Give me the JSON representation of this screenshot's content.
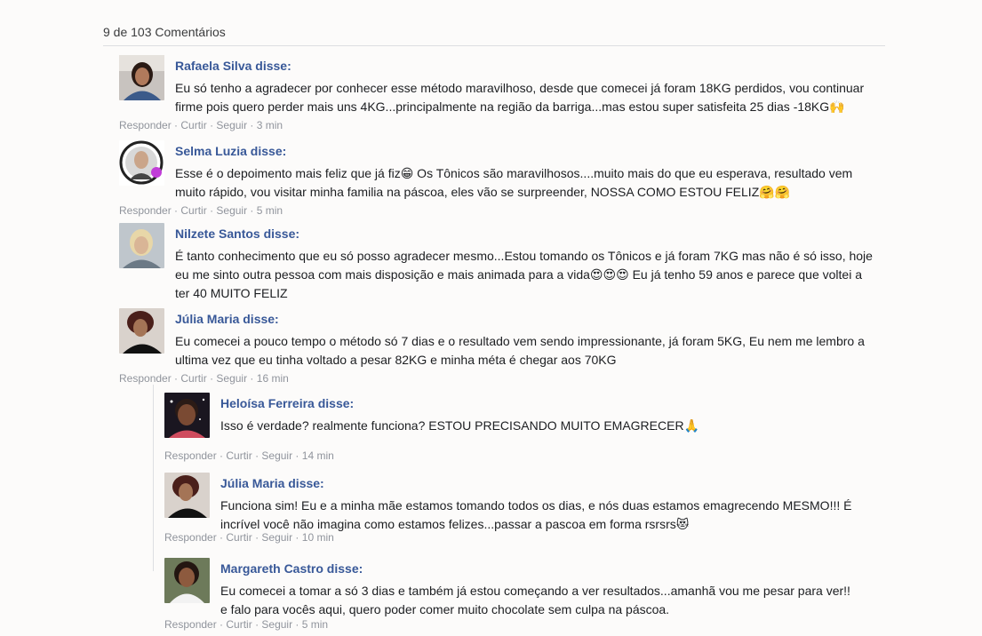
{
  "header": {
    "count_label": "9 de 103 Comentários"
  },
  "actions": {
    "reply": "Responder",
    "like": "Curtir",
    "follow": "Seguir",
    "sep": " · "
  },
  "comments": [
    {
      "name": "Rafaela Silva disse:",
      "text": "Eu só tenho a agradecer por conhecer esse método maravilhoso, desde que comecei já foram 18KG perdidos, vou continuar firme pois quero perder mais uns 4KG...principalmente na região da barriga...mas estou super satisfeita 25 dias -18KG🙌",
      "time": "3 min"
    },
    {
      "name": "Selma Luzia disse:",
      "text": "Esse é o depoimento mais feliz que já fiz😁 Os Tônicos são maravilhosos....muito mais do que eu esperava, resultado vem muito rápido, vou visitar minha familia na páscoa, eles vão se surpreender, NOSSA COMO ESTOU FELIZ🤗🤗",
      "time": "5 min"
    },
    {
      "name": "Nilzete Santos disse:",
      "text": "É tanto conhecimento que eu só posso agradecer mesmo...Estou tomando os Tônicos e já foram 7KG mas não é só isso, hoje eu me sinto outra pessoa com mais disposição e mais animada para a vida😍😍😍 Eu já tenho 59 anos e parece que voltei a ter 40 MUITO FELIZ",
      "time": ""
    },
    {
      "name": "Júlia Maria disse:",
      "text": "Eu comecei a pouco tempo o método só 7 dias e o resultado vem sendo impressionante, já foram 5KG, Eu nem me lembro a ultima vez que eu tinha voltado a pesar 82KG e minha méta é chegar aos 70KG",
      "time": "16 min"
    }
  ],
  "replies": [
    {
      "name": "Heloísa Ferreira disse:",
      "text": "Isso é verdade? realmente funciona? ESTOU PRECISANDO MUITO EMAGRECER🙏",
      "time": "14 min"
    },
    {
      "name": "Júlia Maria disse:",
      "text": "Funciona sim! Eu e a minha mãe estamos tomando todos os dias, e nós duas estamos emagrecendo MESMO!!! É incrível você não imagina como estamos felizes...passar a pascoa em forma rsrsrs😻",
      "time": "10 min"
    },
    {
      "name": "Margareth Castro disse:",
      "text": "Eu comecei a tomar a só 3 dias e também já estou começando a ver resultados...amanhã vou me pesar para ver!! e falo para vocês aqui, quero poder comer muito chocolate sem culpa na páscoa.",
      "time": "5 min"
    }
  ]
}
